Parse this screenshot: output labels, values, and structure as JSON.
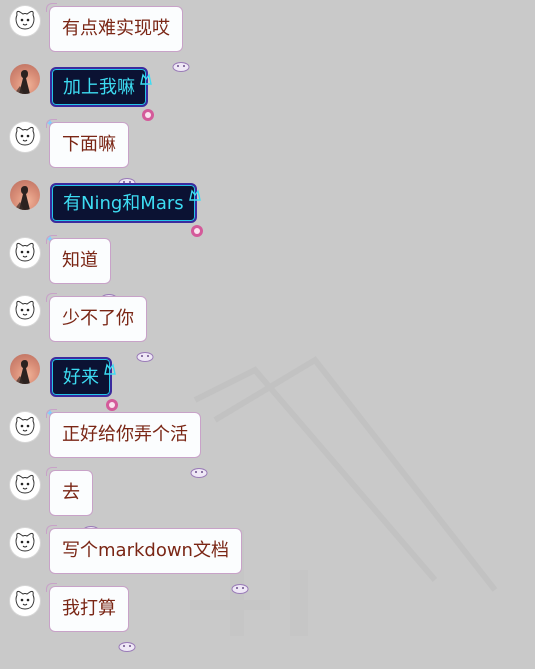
{
  "messages": [
    {
      "sender": "bot",
      "text": "有点难实现哎"
    },
    {
      "sender": "user",
      "text": "加上我嘛"
    },
    {
      "sender": "bot",
      "text": "下面嘛"
    },
    {
      "sender": "user",
      "text": "有Ning和Mars"
    },
    {
      "sender": "bot",
      "text": "知道"
    },
    {
      "sender": "bot",
      "text": "少不了你"
    },
    {
      "sender": "user",
      "text": "好来"
    },
    {
      "sender": "bot",
      "text": "正好给你弄个活"
    },
    {
      "sender": "bot",
      "text": "去"
    },
    {
      "sender": "bot",
      "text": "写个markdown文档"
    },
    {
      "sender": "bot",
      "text": "我打算"
    }
  ],
  "colors": {
    "background": "#c9c9c9",
    "bot_bubble_bg": "#fbfdfe",
    "bot_text": "#7a2615",
    "user_bubble_bg": "#0b1233",
    "user_text": "#3ddcf2"
  },
  "icons": {
    "bot_avatar": "cartoon-dog-avatar",
    "user_avatar": "dark-figure-avatar"
  }
}
